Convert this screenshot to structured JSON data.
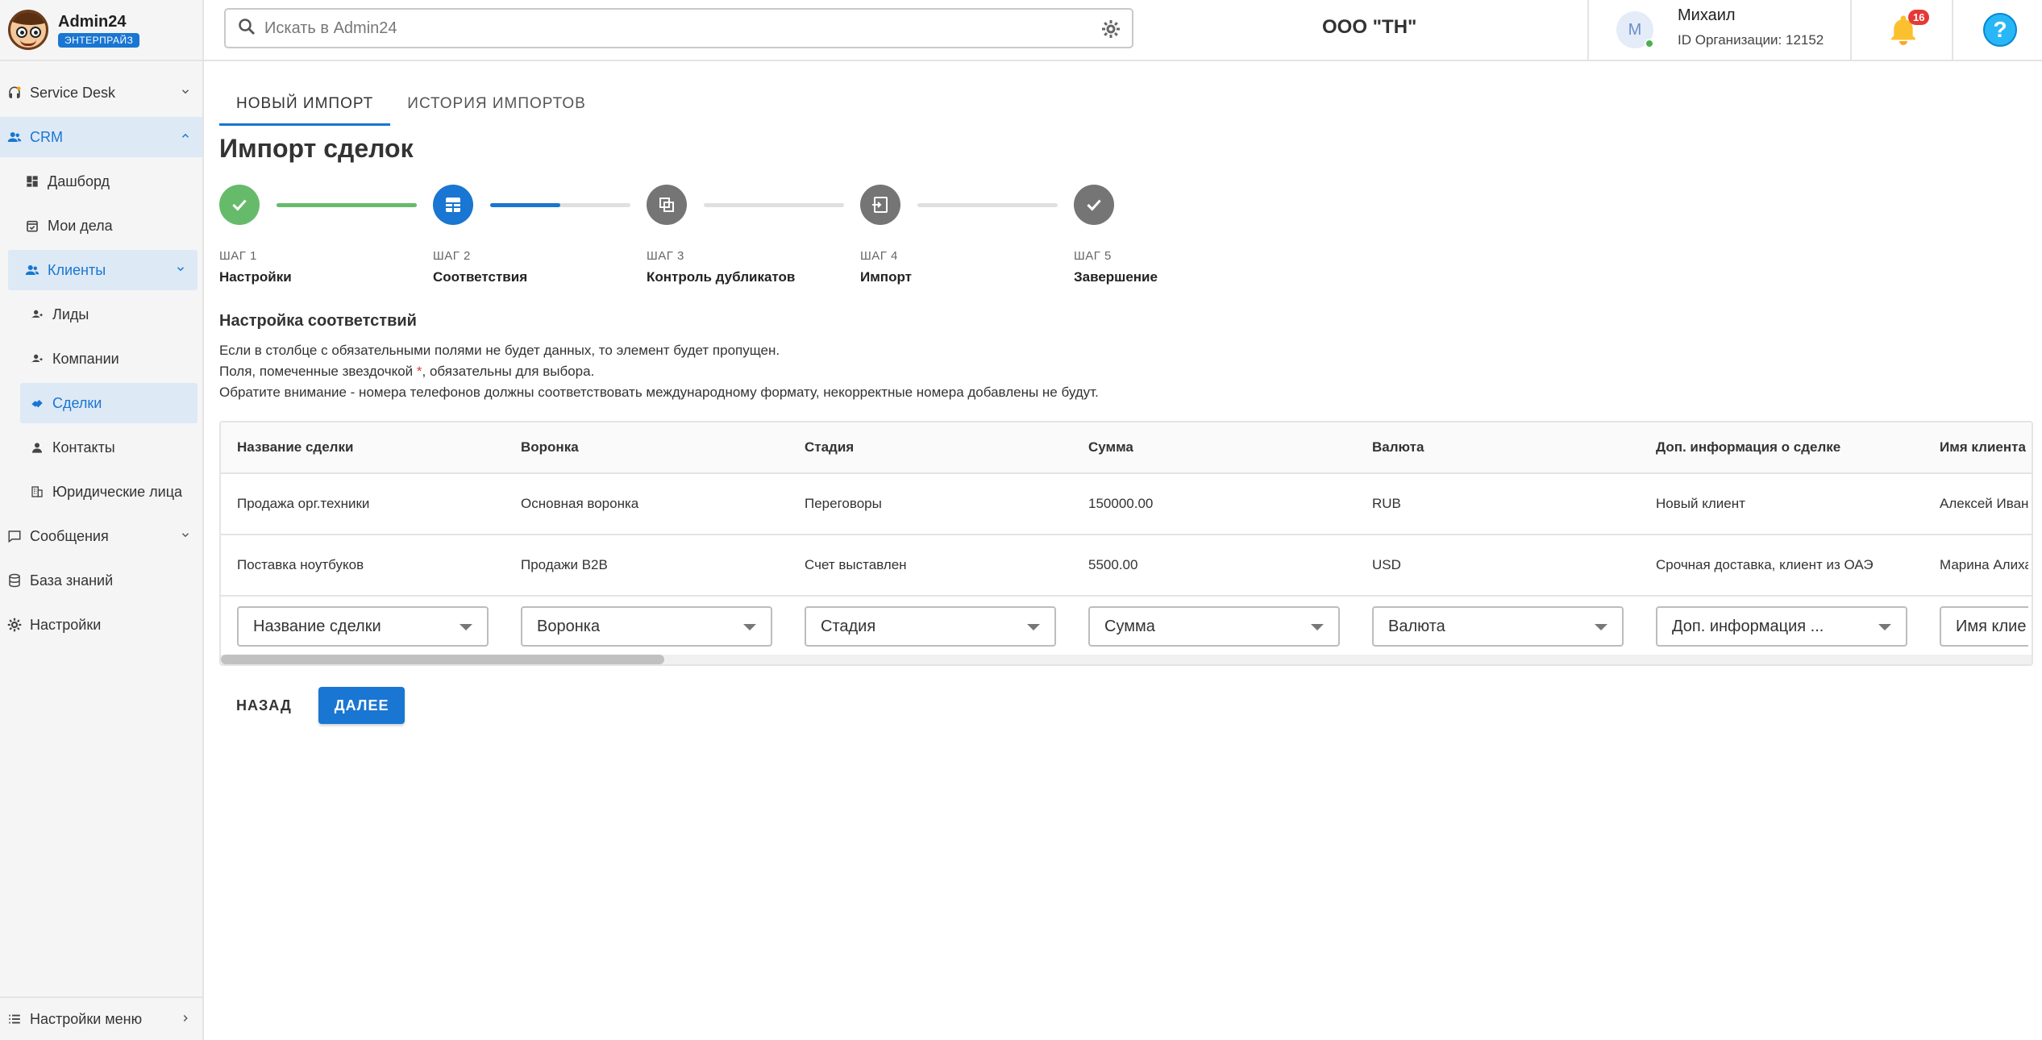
{
  "app": {
    "title": "Admin24",
    "badge": "ЭНТЕРПРАЙЗ"
  },
  "header": {
    "search_placeholder": "Искать в Admin24",
    "org_name": "ООО \"ТН\"",
    "user_initial": "М",
    "user_name": "Михаил",
    "org_id": "ID Организации: 12152",
    "notifications_count": "16",
    "help_label": "?"
  },
  "sidebar": {
    "service_desk": "Service Desk",
    "crm": "CRM",
    "dashboard": "Дашборд",
    "my_tasks": "Мои дела",
    "clients": "Клиенты",
    "leads": "Лиды",
    "companies": "Компании",
    "deals": "Сделки",
    "contacts": "Контакты",
    "legal_entities": "Юридические лица",
    "messages": "Сообщения",
    "knowledge_base": "База знаний",
    "settings": "Настройки",
    "menu_settings": "Настройки меню"
  },
  "tabs": {
    "new_import": "НОВЫЙ ИМПОРТ",
    "history": "ИСТОРИЯ ИМПОРТОВ"
  },
  "page_title": "Импорт сделок",
  "stepper": {
    "steps": [
      {
        "label": "ШАГ 1",
        "name": "Настройки",
        "state": "done"
      },
      {
        "label": "ШАГ 2",
        "name": "Соответствия",
        "state": "current"
      },
      {
        "label": "ШАГ 3",
        "name": "Контроль дубликатов",
        "state": "pending"
      },
      {
        "label": "ШАГ 4",
        "name": "Импорт",
        "state": "pending"
      },
      {
        "label": "ШАГ 5",
        "name": "Завершение",
        "state": "pending"
      }
    ],
    "progress": [
      1.0,
      0.5,
      0.0,
      0.0
    ]
  },
  "mapping": {
    "title": "Настройка соответствий",
    "info1": "Если в столбце с обязательными полями не будет данных, то элемент будет пропущен.",
    "info2_before": "Поля, помеченные звездочкой ",
    "info2_star": "*",
    "info2_after": ", обязательны для выбора.",
    "info3": "Обратите внимание - номера телефонов должны соответствовать международному формату, некорректные номера добавлены не будут."
  },
  "table": {
    "headers": [
      "Название сделки",
      "Воронка",
      "Стадия",
      "Сумма",
      "Валюта",
      "Доп. информация о сделке",
      "Имя клиента"
    ],
    "rows": [
      [
        "Продажа орг.техники",
        "Основная воронка",
        "Переговоры",
        "150000.00",
        "RUB",
        "Новый клиент",
        "Алексей Иван"
      ],
      [
        "Поставка ноутбуков",
        "Продажи B2B",
        "Счет выставлен",
        "5500.00",
        "USD",
        "Срочная доставка, клиент из ОАЭ",
        "Марина Алиха"
      ]
    ],
    "selects": [
      "Название сделки",
      "Воронка",
      "Стадия",
      "Сумма",
      "Валюта",
      "Доп. информация ...",
      "Имя клие"
    ]
  },
  "actions": {
    "back": "НАЗАД",
    "next": "ДАЛЕЕ"
  },
  "colors": {
    "accent": "#1976d2",
    "done": "#66bb6a",
    "pending": "#757575"
  }
}
